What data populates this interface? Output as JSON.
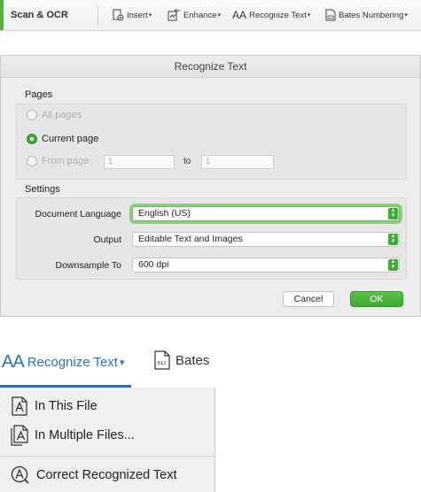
{
  "toolbar": {
    "title": "Scan & OCR",
    "insert_label": "Insert",
    "enhance_label": "Enhance",
    "recognize_label": "Recognize Text",
    "bates_label": "Bates Numbering",
    "caret": "▾",
    "aa_glyph": "AA"
  },
  "dialog": {
    "title": "Recognize Text",
    "pages_heading": "Pages",
    "radio_all": "All pages",
    "radio_current": "Current page",
    "radio_from": "From page",
    "from_value": "1",
    "to_label": "to",
    "to_value": "1",
    "settings_heading": "Settings",
    "language_label": "Document Language",
    "language_value": "English (US)",
    "output_label": "Output",
    "output_value": "Editable Text and Images",
    "downsample_label": "Downsample To",
    "downsample_value": "600 dpi",
    "cancel_label": "Cancel",
    "ok_label": "OK"
  },
  "zoom": {
    "aa_glyph": "AA",
    "recognize_label": "Recognize Text",
    "caret": "▾",
    "bates_label": "Bates",
    "bates_icon_text": "012",
    "menu": {
      "items": [
        {
          "label": "In This File"
        },
        {
          "label": "In Multiple Files..."
        },
        {
          "label": "Correct Recognized Text"
        }
      ]
    }
  },
  "colors": {
    "accent_green": "#3faa3a",
    "link_blue": "#2d6fb5"
  },
  "icons": [
    "insert-icon",
    "enhance-icon",
    "recognize-text-icon",
    "bates-icon",
    "file-text-icon",
    "multiple-files-icon",
    "correct-text-icon"
  ]
}
